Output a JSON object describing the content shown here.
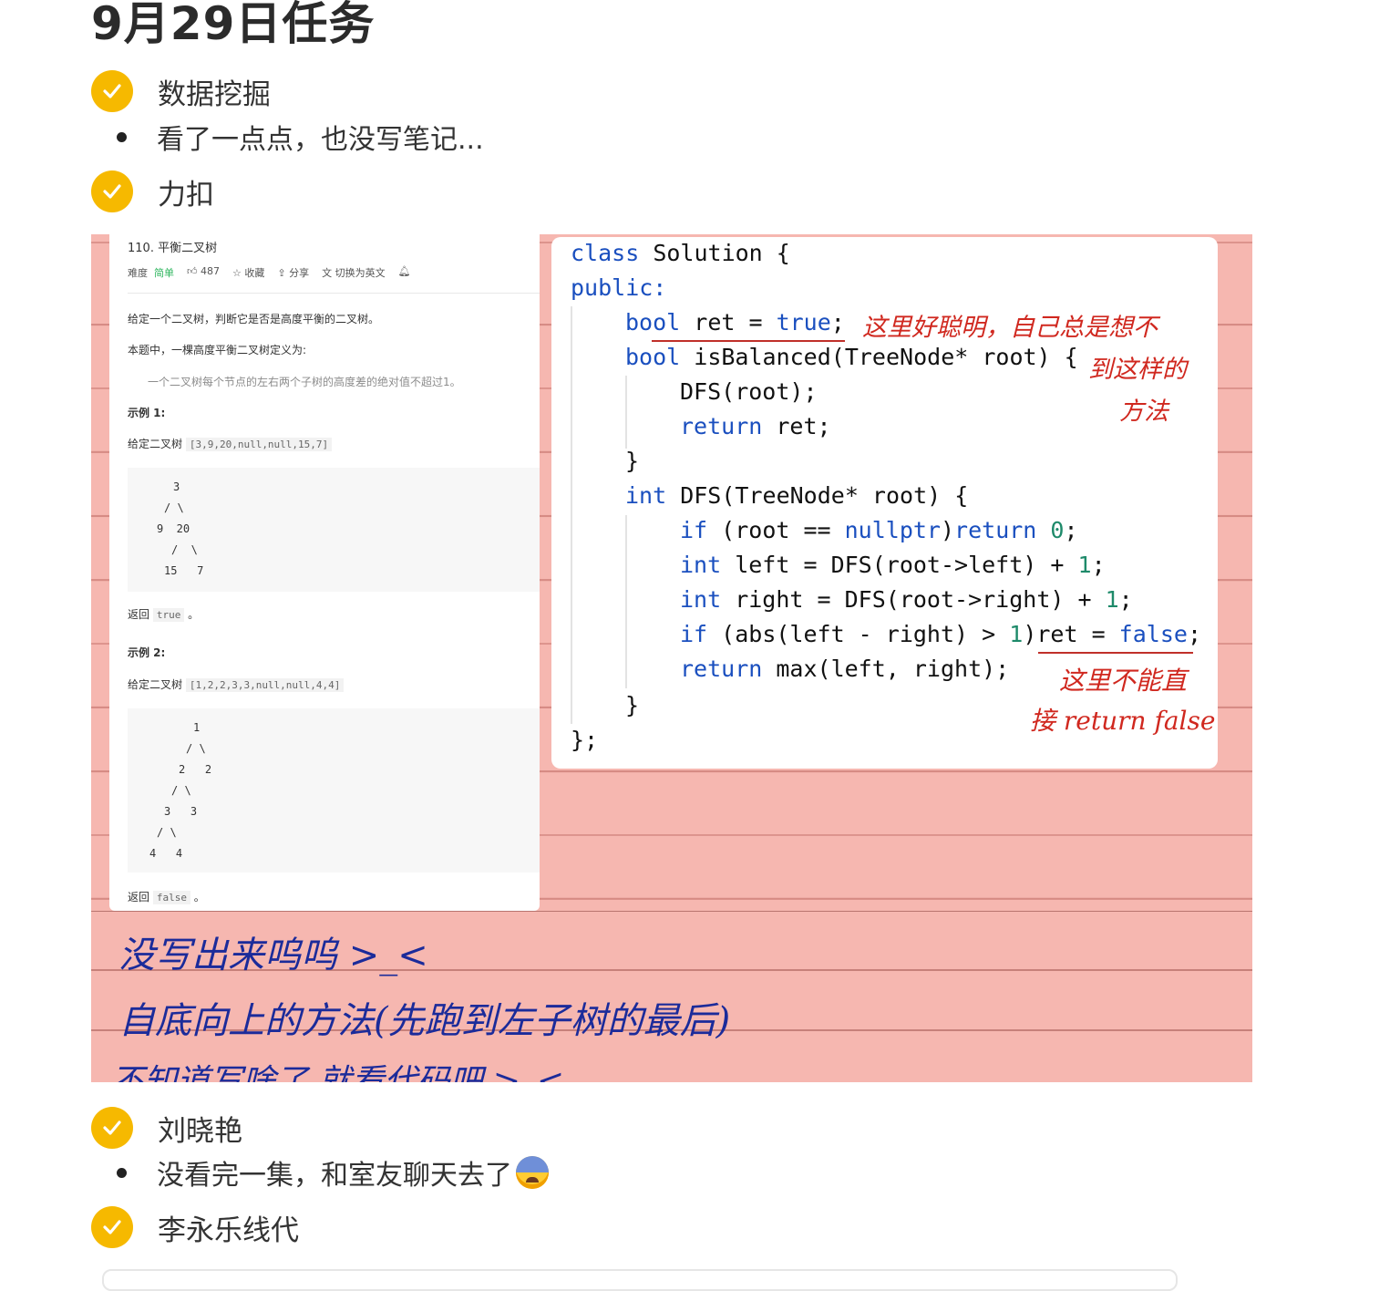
{
  "page_title": "9月29日任务",
  "colors": {
    "check": "#f6b900",
    "paper": "#f6b7b0",
    "red_ink": "#d0281f",
    "blue_ink": "#1b2b9a",
    "keyword": "#1a4fbf"
  },
  "tasks": [
    {
      "label": "数据挖掘",
      "checked": true,
      "icon": "check-icon"
    },
    {
      "label": "力扣",
      "checked": true,
      "icon": "check-icon"
    },
    {
      "label": "刘晓艳",
      "checked": true,
      "icon": "check-icon"
    },
    {
      "label": "李永乐线代",
      "checked": true,
      "icon": "check-icon"
    }
  ],
  "notes": [
    {
      "text": "看了一点点，也没写笔记..."
    },
    {
      "text": "没看完一集，和室友聊天去了",
      "emoji": "anxious-sweat-face-emoji"
    }
  ],
  "problem": {
    "title": "110. 平衡二叉树",
    "difficulty_label": "难度",
    "difficulty": "简单",
    "likes": "487",
    "favorite": "收藏",
    "share": "分享",
    "switch_lang": "切换为英文",
    "description": "给定一个二叉树，判断它是否是高度平衡的二叉树。",
    "definition_intro": "本题中，一棵高度平衡二叉树定义为:",
    "definition": "一个二叉树每个节点的左右两个子树的高度差的绝对值不超过1。",
    "example1_title": "示例 1:",
    "example1_given": "给定二叉树",
    "example1_array": "[3,9,20,null,null,15,7]",
    "example1_tree": [
      "3",
      "/ \\",
      "9  20",
      "/  \\",
      "15   7"
    ],
    "example1_return_label": "返回",
    "example1_return": "true",
    "example2_title": "示例 2:",
    "example2_given": "给定二叉树",
    "example2_array": "[1,2,2,3,3,null,null,4,4]",
    "example2_tree": [
      "1",
      "/ \\",
      "2   2",
      "/ \\",
      "3   3",
      "/ \\",
      "4   4"
    ],
    "example2_return_label": "返回",
    "example2_return": "false",
    "period": "。"
  },
  "code": {
    "l1a": "class",
    "l1b": " Solution {",
    "l2": "public:",
    "l3a": "bool",
    "l3b": " ret = ",
    "l3c": "true",
    "l3d": ";",
    "l4a": "bool",
    "l4b": " isBalanced(TreeNode* root) {",
    "l5": "DFS(root);",
    "l6a": "return",
    "l6b": " ret;",
    "l7": "}",
    "l8a": "int",
    "l8b": " DFS(TreeNode* root) {",
    "l9a": "if",
    "l9b": " (root == ",
    "l9c": "nullptr",
    "l9d": ")",
    "l9e": "return",
    "l9f": " ",
    "l9g": "0",
    "l9h": ";",
    "l10a": "int",
    "l10b": " left = DFS(root->left) + ",
    "l10c": "1",
    "l10d": ";",
    "l11a": "int",
    "l11b": " right = DFS(root->right) + ",
    "l11c": "1",
    "l11d": ";",
    "l12a": "if",
    "l12b": " (abs(left - right) > ",
    "l12c": "1",
    "l12d": ")ret = ",
    "l12e": "false",
    "l12f": ";",
    "l13a": "return",
    "l13b": " max(left, right);",
    "l14": "}",
    "l15": "};"
  },
  "handwriting": {
    "red1_line1": "这里好聪明，自己总是想不",
    "red1_line2": "到这样的",
    "red1_line3": "方法",
    "red2_line1": "这里不能直",
    "red2_line2": "接 return false",
    "blue1": "没写出来呜呜 >_<",
    "blue2": "自底向上的方法(先跑到左子树的最后)",
    "blue3": "不知道写啥了 就看代码吧 >_<"
  }
}
